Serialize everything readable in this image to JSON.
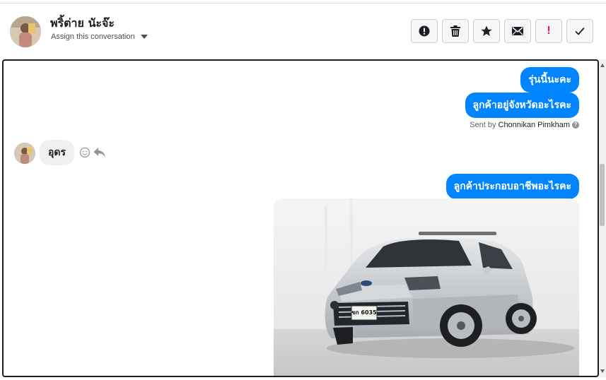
{
  "header": {
    "contact_name": "พริ้ต่าย นัะจ๊ะ",
    "assign_label": "Assign this conversation",
    "avatar_icon": "avatar-photo",
    "tools": [
      {
        "name": "mark-spam-button",
        "icon": "exclamation-circle-icon"
      },
      {
        "name": "delete-button",
        "icon": "trash-icon"
      },
      {
        "name": "star-button",
        "icon": "star-icon"
      },
      {
        "name": "mark-unread-button",
        "icon": "envelope-icon"
      },
      {
        "name": "important-button",
        "icon": "exclamation-icon",
        "label": "!"
      },
      {
        "name": "mark-done-button",
        "icon": "checkmark-icon"
      }
    ]
  },
  "messages": {
    "out1": "รุ่นนี้นะคะ",
    "out2": "ลูกค้าอยู่จังหวัดอะไรคะ",
    "sent_prefix": "Sent by",
    "sent_by": "Chonnikan Pimkham",
    "in1": "อุดร",
    "out3": "ลูกค้าประกอบอาชีพอะไรคะ",
    "image": "car-photo",
    "plate_text": "ขก 6035"
  },
  "colors": {
    "outgoing": "#0084ff",
    "incoming": "#f1f0f0",
    "danger": "#e41e3f"
  }
}
